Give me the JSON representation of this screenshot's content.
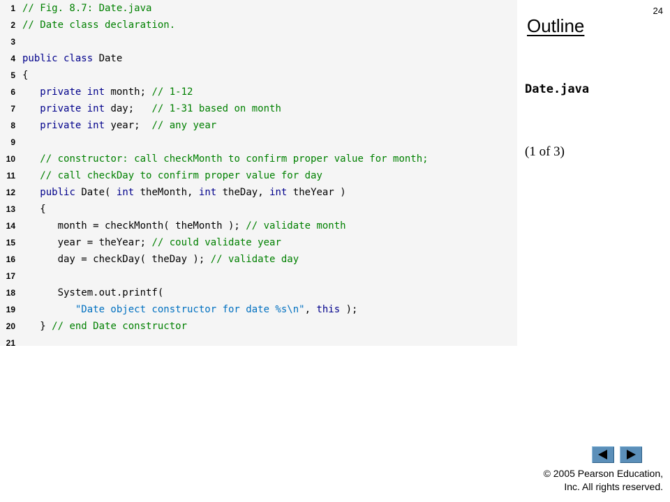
{
  "slide": {
    "page_number": "24",
    "outline_title": "Outline",
    "file_name": "Date.java",
    "page_indicator": "(1 of  3)",
    "copyright_line1": "© 2005 Pearson Education,",
    "copyright_line2": "Inc.  All rights reserved.",
    "nav": {
      "prev_icon": "triangle-left-icon",
      "next_icon": "triangle-right-icon"
    }
  },
  "colors": {
    "comment": "#008000",
    "keyword": "#00008b",
    "text": "#000000",
    "string": "#0070c0",
    "code_background": "#f5f5f5",
    "nav_button": "#5b8fb9"
  },
  "code": {
    "lines": [
      {
        "num": "1",
        "tokens": [
          {
            "t": "cm",
            "s": "// Fig. 8.7: Date.java"
          }
        ]
      },
      {
        "num": "2",
        "tokens": [
          {
            "t": "cm",
            "s": "// Date class declaration."
          }
        ]
      },
      {
        "num": "3",
        "tokens": []
      },
      {
        "num": "4",
        "tokens": [
          {
            "t": "kw",
            "s": "public class "
          },
          {
            "t": "tx",
            "s": "Date"
          }
        ]
      },
      {
        "num": "5",
        "tokens": [
          {
            "t": "tx",
            "s": "{"
          }
        ]
      },
      {
        "num": "6",
        "tokens": [
          {
            "t": "tx",
            "s": "   "
          },
          {
            "t": "kw",
            "s": "private int "
          },
          {
            "t": "tx",
            "s": "month; "
          },
          {
            "t": "cm",
            "s": "// 1-12"
          }
        ]
      },
      {
        "num": "7",
        "tokens": [
          {
            "t": "tx",
            "s": "   "
          },
          {
            "t": "kw",
            "s": "private int "
          },
          {
            "t": "tx",
            "s": "day;   "
          },
          {
            "t": "cm",
            "s": "// 1-31 based on month"
          }
        ]
      },
      {
        "num": "8",
        "tokens": [
          {
            "t": "tx",
            "s": "   "
          },
          {
            "t": "kw",
            "s": "private int "
          },
          {
            "t": "tx",
            "s": "year;  "
          },
          {
            "t": "cm",
            "s": "// any year"
          }
        ]
      },
      {
        "num": "9",
        "tokens": []
      },
      {
        "num": "10",
        "tokens": [
          {
            "t": "tx",
            "s": "   "
          },
          {
            "t": "cm",
            "s": "// constructor: call checkMonth to confirm proper value for month;"
          }
        ]
      },
      {
        "num": "11",
        "tokens": [
          {
            "t": "tx",
            "s": "   "
          },
          {
            "t": "cm",
            "s": "// call checkDay to confirm proper value for day"
          }
        ]
      },
      {
        "num": "12",
        "tokens": [
          {
            "t": "tx",
            "s": "   "
          },
          {
            "t": "kw",
            "s": "public "
          },
          {
            "t": "tx",
            "s": "Date( "
          },
          {
            "t": "kw",
            "s": "int "
          },
          {
            "t": "tx",
            "s": "theMonth, "
          },
          {
            "t": "kw",
            "s": "int "
          },
          {
            "t": "tx",
            "s": "theDay, "
          },
          {
            "t": "kw",
            "s": "int "
          },
          {
            "t": "tx",
            "s": "theYear )"
          }
        ]
      },
      {
        "num": "13",
        "tokens": [
          {
            "t": "tx",
            "s": "   {"
          }
        ]
      },
      {
        "num": "14",
        "tokens": [
          {
            "t": "tx",
            "s": "      month = checkMonth( theMonth ); "
          },
          {
            "t": "cm",
            "s": "// validate month"
          }
        ]
      },
      {
        "num": "15",
        "tokens": [
          {
            "t": "tx",
            "s": "      year = theYear; "
          },
          {
            "t": "cm",
            "s": "// could validate year"
          }
        ]
      },
      {
        "num": "16",
        "tokens": [
          {
            "t": "tx",
            "s": "      day = checkDay( theDay ); "
          },
          {
            "t": "cm",
            "s": "// validate day"
          }
        ]
      },
      {
        "num": "17",
        "tokens": []
      },
      {
        "num": "18",
        "tokens": [
          {
            "t": "tx",
            "s": "      System.out.printf("
          }
        ]
      },
      {
        "num": "19",
        "tokens": [
          {
            "t": "tx",
            "s": "         "
          },
          {
            "t": "st",
            "s": "\"Date object constructor for date %s\\n\""
          },
          {
            "t": "tx",
            "s": ", "
          },
          {
            "t": "kw",
            "s": "this"
          },
          {
            "t": "tx",
            "s": " );"
          }
        ]
      },
      {
        "num": "20",
        "tokens": [
          {
            "t": "tx",
            "s": "   } "
          },
          {
            "t": "cm",
            "s": "// end Date constructor"
          }
        ]
      },
      {
        "num": "21",
        "tokens": []
      }
    ]
  }
}
